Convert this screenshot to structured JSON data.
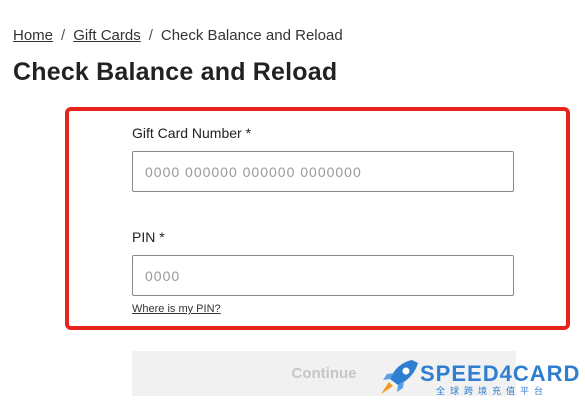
{
  "breadcrumb": {
    "home": "Home",
    "separator": "/",
    "gift_cards": "Gift Cards",
    "current": "Check Balance and Reload"
  },
  "page_title": "Check Balance and Reload",
  "form": {
    "card_number": {
      "label": "Gift Card Number *",
      "value": "",
      "placeholder": "0000 000000 000000 0000000"
    },
    "pin": {
      "label": "PIN *",
      "value": "",
      "placeholder": "0000"
    },
    "pin_help": "Where is my PIN?",
    "continue_label": "Continue"
  },
  "watermark": {
    "text": "SPEED4CARD",
    "subtitle": "全球跨境充值平台"
  },
  "colors": {
    "highlight": "#e8231c",
    "watermark": "#2f7fd0",
    "button_disabled_bg": "#f1f1f1"
  }
}
